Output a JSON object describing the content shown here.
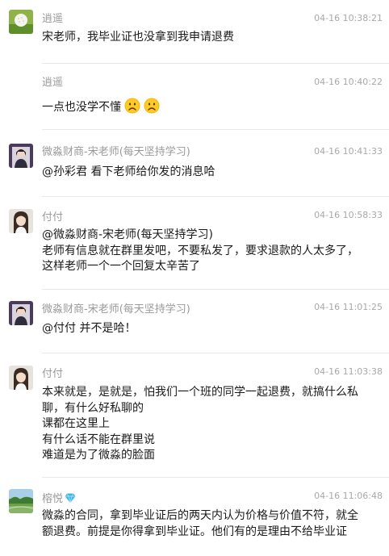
{
  "messages": [
    {
      "name": "逍遥",
      "time": "04-16 10:38:21",
      "avatar": "golf-ball-avatar",
      "lines": [
        "宋老师，我毕业证也没拿到我申请退费"
      ]
    },
    {
      "name": "逍遥",
      "time": "04-16 10:40:22",
      "avatar": "none",
      "lines": [
        "一点也没学不懂"
      ],
      "emojis": [
        "frown-emoji",
        "frown-emoji"
      ]
    },
    {
      "name": "微淼财商-宋老师(每天坚持学习)",
      "time": "04-16 10:41:33",
      "avatar": "woman-portrait-avatar",
      "lines": [
        "@孙彩君 看下老师给你发的消息哈"
      ]
    },
    {
      "name": "付付",
      "time": "04-16 10:58:33",
      "avatar": "girl-portrait-avatar",
      "lines": [
        "@微淼财商-宋老师(每天坚持学习)",
        "老师有信息就在群里发吧，不要私发了，要求退款的人太多了，",
        "这样老师一个一个回复太辛苦了"
      ]
    },
    {
      "name": "微淼财商-宋老师(每天坚持学习)",
      "time": "04-16 11:01:25",
      "avatar": "woman-portrait-avatar",
      "lines": [
        "@付付 并不是哈！"
      ]
    },
    {
      "name": "付付",
      "time": "04-16 11:03:38",
      "avatar": "girl-portrait-avatar",
      "lines": [
        "本来就是，是就是，怕我们一个班的同学一起退费，就搞什么私",
        "聊，有什么好私聊的",
        "课都在这里上",
        "有什么话不能在群里说",
        "难道是为了微淼的脸面"
      ]
    },
    {
      "name": "榕悦",
      "time": "04-16 11:06:48",
      "avatar": "landscape-avatar",
      "name_icon": "diamond-icon",
      "lines": [
        "微淼的合同，拿到毕业证后的两天内认为价格与价值不符，就全",
        "额退费。前提是你得拿到毕业证。他们有的是理由不给毕业证"
      ]
    }
  ],
  "colors": {
    "name": "#9a9a9a",
    "time": "#a8a8a8",
    "text": "#1a1a1a",
    "divider": "#e8e8e8",
    "emoji": "#f5b400",
    "gem": "#3fb6ea"
  }
}
